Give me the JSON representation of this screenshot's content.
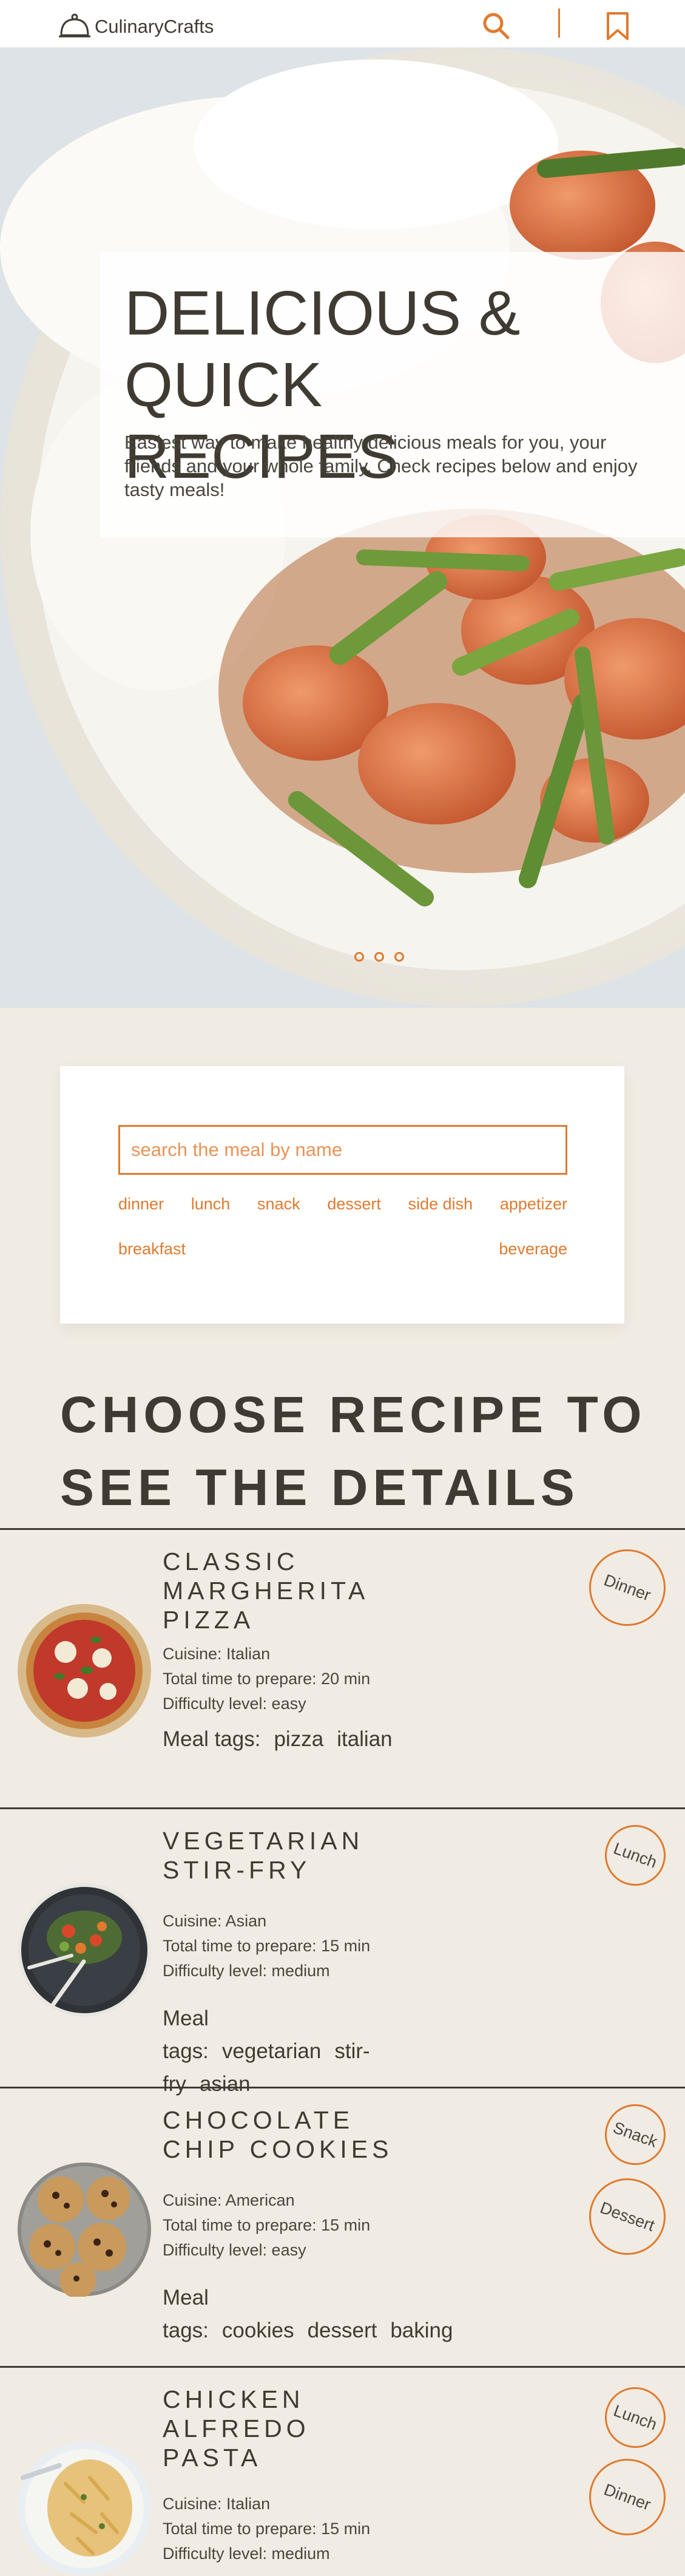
{
  "app": {
    "name": "CulinaryCrafts",
    "accent_color": "#e07a2f",
    "text_color": "#3f3b32",
    "background_color": "#f1ece3",
    "icons": [
      "cloche-icon",
      "search-icon",
      "bookmark-icon"
    ]
  },
  "hero": {
    "title": "DELICIOUS & QUICK RECIPES",
    "subtitle": "Easiest way to make healthy delicious meals for you, your friends and your whole family. Check recipes below and enjoy tasty meals!",
    "slides": 3
  },
  "search": {
    "placeholder": "search the meal by name",
    "tags": [
      "dinner",
      "lunch",
      "snack",
      "dessert",
      "side dish",
      "appetizer",
      "breakfast",
      "beverage"
    ]
  },
  "section_title": "CHOOSE RECIPE TO SEE THE DETAILS",
  "recipes": [
    {
      "title": "CLASSIC MARGHERITA PIZZA",
      "cuisine": "Cuisine: Italian",
      "time": "Total time to prepare: 20 min",
      "difficulty": "Difficulty level: easy",
      "tags_label": "Meal tags:",
      "tags": [
        "pizza",
        "italian"
      ],
      "badges": [
        "Dinner"
      ]
    },
    {
      "title": "VEGETARIAN STIR-FRY",
      "cuisine": "Cuisine: Asian",
      "time": "Total time to prepare: 15 min",
      "difficulty": "Difficulty level: medium",
      "tags_label": "Meal tags:",
      "tags": [
        "vegetarian",
        "stir-fry",
        "asian"
      ],
      "badges": [
        "Lunch"
      ]
    },
    {
      "title": "CHOCOLATE CHIP COOKIES",
      "cuisine": "Cuisine: American",
      "time": "Total time to prepare: 15 min",
      "difficulty": "Difficulty level: easy",
      "tags_label": "Meal tags:",
      "tags": [
        "cookies",
        "dessert",
        "baking"
      ],
      "badges": [
        "Snack",
        "Dessert"
      ]
    },
    {
      "title": "CHICKEN ALFREDO PASTA",
      "cuisine": "Cuisine: Italian",
      "time": "Total time to prepare: 15 min",
      "difficulty": "Difficulty level: medium",
      "tags_label": "",
      "tags": [],
      "badges": [
        "Lunch",
        "Dinner"
      ]
    }
  ]
}
